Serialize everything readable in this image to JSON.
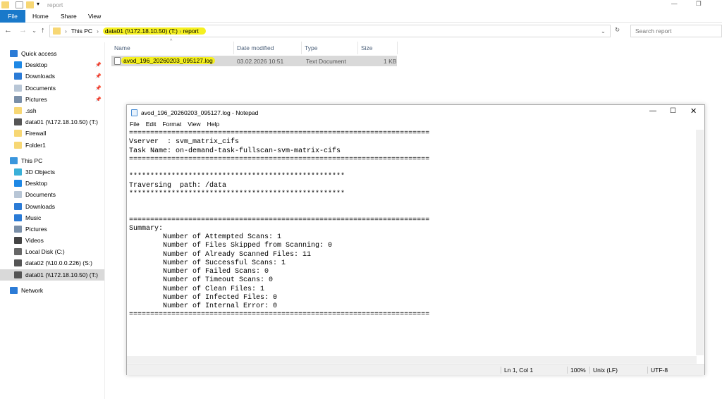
{
  "explorer": {
    "title": "report",
    "ribbon_tabs": [
      "File",
      "Home",
      "Share",
      "View"
    ],
    "address": {
      "crumbs": [
        "This PC",
        "data01 (\\\\172.18.10.50) (T:)",
        "report"
      ]
    },
    "search_placeholder": "Search report",
    "columns": [
      "Name",
      "Date modified",
      "Type",
      "Size"
    ],
    "files": [
      {
        "name": "avod_196_20260203_095127.log",
        "date": "03.02.2026 10:51",
        "type": "Text Document",
        "size": "1 KB"
      }
    ],
    "nav": [
      {
        "label": "Quick access",
        "level": "top",
        "icon": "star-icon",
        "color": "#2b7bd6"
      },
      {
        "label": "Desktop",
        "icon": "desktop-icon",
        "pinned": true,
        "color": "#1e88e5"
      },
      {
        "label": "Downloads",
        "icon": "download-icon",
        "pinned": true,
        "color": "#2b7bd6"
      },
      {
        "label": "Documents",
        "icon": "documents-icon",
        "pinned": true,
        "color": "#b8c6d6"
      },
      {
        "label": "Pictures",
        "icon": "pictures-icon",
        "pinned": true,
        "color": "#7a8fa8"
      },
      {
        "label": ".ssh",
        "icon": "folder-icon",
        "color": "#f7d774"
      },
      {
        "label": "data01 (\\\\172.18.10.50) (T:)",
        "icon": "network-drive-icon",
        "color": "#555"
      },
      {
        "label": "Firewall",
        "icon": "folder-icon",
        "color": "#f7d774"
      },
      {
        "label": "Folder1",
        "icon": "folder-icon",
        "color": "#f7d774"
      },
      {
        "label": "This PC",
        "level": "top",
        "icon": "computer-icon",
        "color": "#3a96dd"
      },
      {
        "label": "3D Objects",
        "icon": "3d-objects-icon",
        "color": "#3ab0d8"
      },
      {
        "label": "Desktop",
        "icon": "desktop-icon",
        "color": "#1e88e5"
      },
      {
        "label": "Documents",
        "icon": "documents-icon",
        "color": "#b8c6d6"
      },
      {
        "label": "Downloads",
        "icon": "download-icon",
        "color": "#2b7bd6"
      },
      {
        "label": "Music",
        "icon": "music-icon",
        "color": "#2b7bd6"
      },
      {
        "label": "Pictures",
        "icon": "pictures-icon",
        "color": "#7a8fa8"
      },
      {
        "label": "Videos",
        "icon": "videos-icon",
        "color": "#444"
      },
      {
        "label": "Local Disk (C:)",
        "icon": "disk-icon",
        "color": "#666"
      },
      {
        "label": "data02 (\\\\10.0.0.226) (S:)",
        "icon": "network-drive-icon",
        "color": "#555"
      },
      {
        "label": "data01 (\\\\172.18.10.50) (T:)",
        "icon": "network-drive-icon",
        "color": "#555",
        "selected": true
      },
      {
        "label": "Network",
        "level": "top",
        "icon": "network-icon",
        "color": "#2b7bd6"
      }
    ]
  },
  "notepad": {
    "title": "avod_196_20260203_095127.log - Notepad",
    "menu": [
      "File",
      "Edit",
      "Format",
      "View",
      "Help"
    ],
    "content": "=======================================================================\nVserver  : svm_matrix_cifs\nTask Name: on-demand-task-fullscan-svm-matrix-cifs\n=======================================================================\n\n***************************************************\nTraversing  path: /data\n***************************************************\n\n\n=======================================================================\nSummary:\n        Number of Attempted Scans: 1\n        Number of Files Skipped from Scanning: 0\n        Number of Already Scanned Files: 11\n        Number of Successful Scans: 1\n        Number of Failed Scans: 0\n        Number of Timeout Scans: 0\n        Number of Clean Files: 1\n        Number of Infected Files: 0\n        Number of Internal Error: 0\n=======================================================================",
    "status": {
      "position": "Ln 1, Col 1",
      "zoom": "100%",
      "eol": "Unix (LF)",
      "encoding": "UTF-8"
    }
  }
}
